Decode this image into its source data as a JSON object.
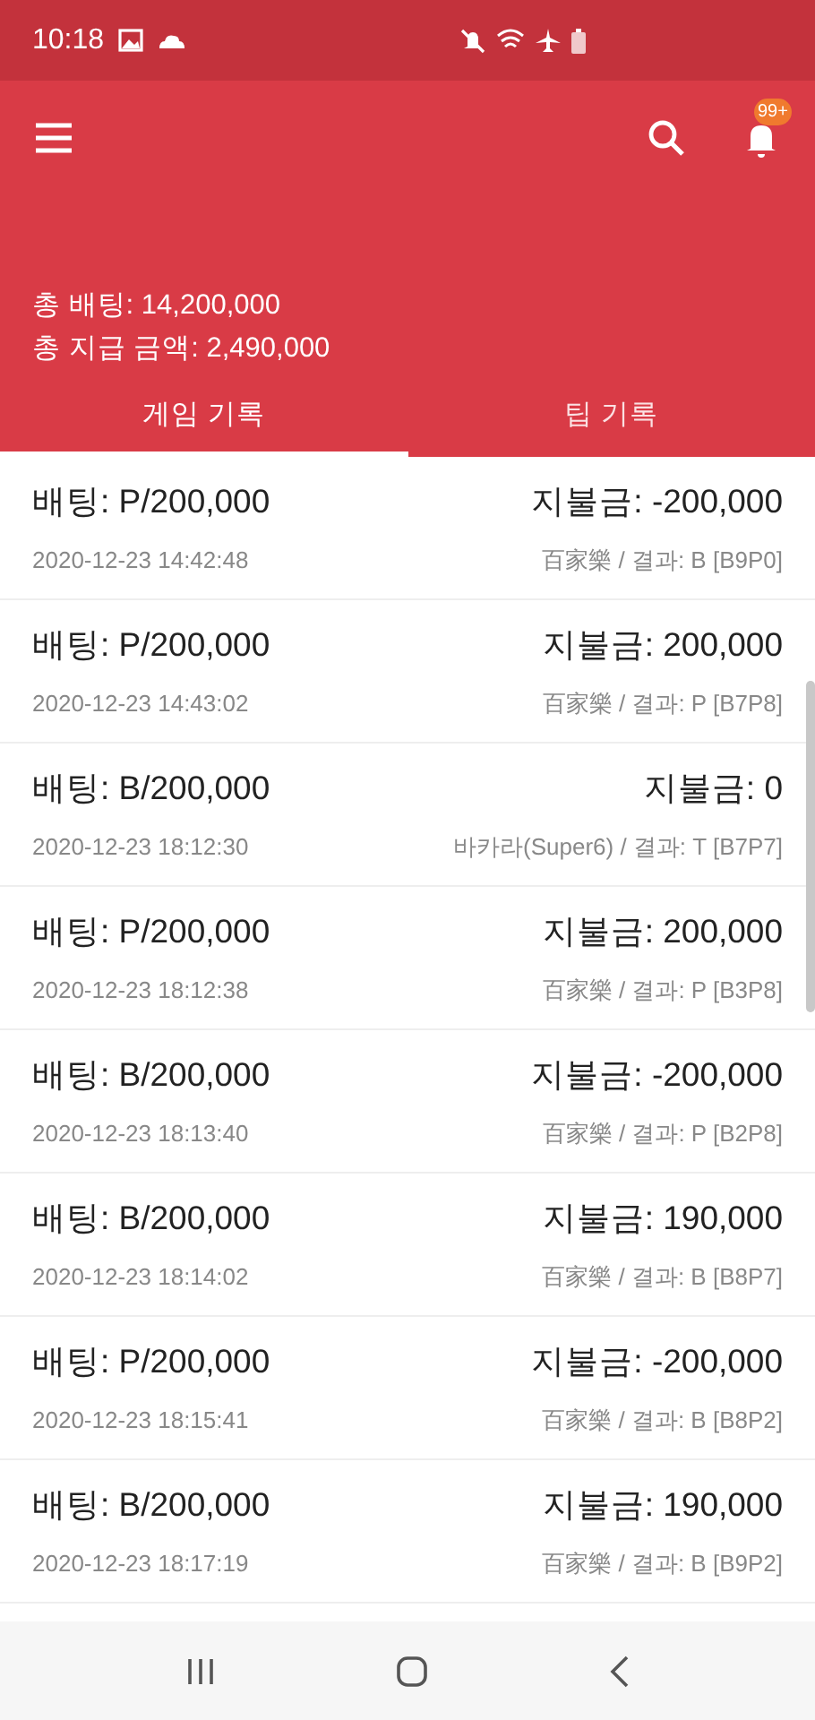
{
  "status_bar": {
    "time": "10:18"
  },
  "summary": {
    "total_bet": "총 배팅: 14,200,000",
    "total_payout": "총 지급 금액: 2,490,000"
  },
  "notification_badge": "99+",
  "tabs": [
    {
      "label": "게임 기록",
      "selected": true
    },
    {
      "label": "팁 기록",
      "selected": false
    }
  ],
  "records": [
    {
      "bet": "배팅: P/200,000",
      "payout": "지불금: -200,000",
      "time": "2020-12-23 14:42:48",
      "result": "百家樂 / 결과: B [B9P0]"
    },
    {
      "bet": "배팅: P/200,000",
      "payout": "지불금: 200,000",
      "time": "2020-12-23 14:43:02",
      "result": "百家樂 / 결과: P [B7P8]"
    },
    {
      "bet": "배팅: B/200,000",
      "payout": "지불금: 0",
      "time": "2020-12-23 18:12:30",
      "result": "바카라(Super6) / 결과: T [B7P7]"
    },
    {
      "bet": "배팅: P/200,000",
      "payout": "지불금: 200,000",
      "time": "2020-12-23 18:12:38",
      "result": "百家樂 / 결과: P [B3P8]"
    },
    {
      "bet": "배팅: B/200,000",
      "payout": "지불금: -200,000",
      "time": "2020-12-23 18:13:40",
      "result": "百家樂 / 결과: P [B2P8]"
    },
    {
      "bet": "배팅: B/200,000",
      "payout": "지불금: 190,000",
      "time": "2020-12-23 18:14:02",
      "result": "百家樂 / 결과: B [B8P7]"
    },
    {
      "bet": "배팅: P/200,000",
      "payout": "지불금: -200,000",
      "time": "2020-12-23 18:15:41",
      "result": "百家樂 / 결과: B [B8P2]"
    },
    {
      "bet": "배팅: B/200,000",
      "payout": "지불금: 190,000",
      "time": "2020-12-23 18:17:19",
      "result": "百家樂 / 결과: B [B9P2]"
    }
  ]
}
